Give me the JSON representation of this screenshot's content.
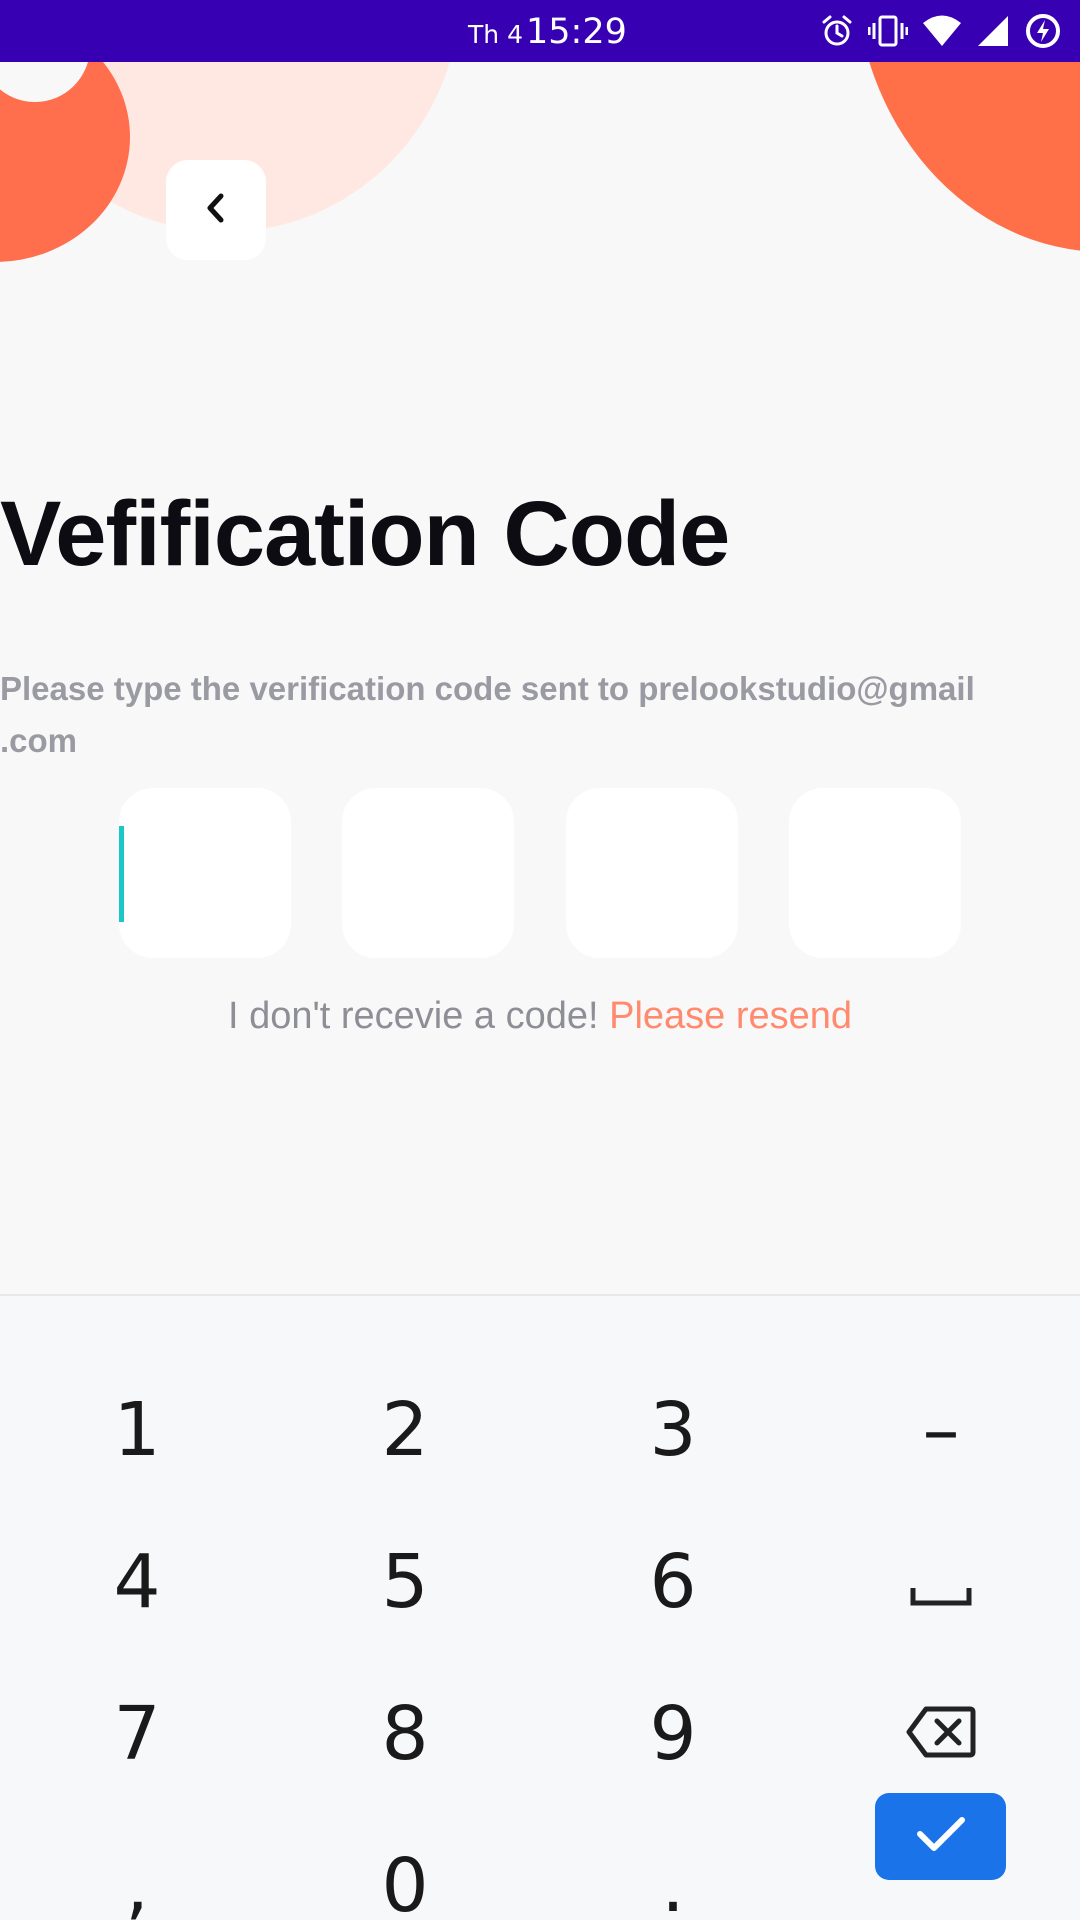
{
  "status_bar": {
    "date": "Th 4",
    "time": "15:29",
    "icons": [
      "alarm-icon",
      "vibrate-icon",
      "wifi-icon",
      "signal-icon",
      "battery-charging-icon"
    ],
    "bg_color": "#3700b3"
  },
  "header": {
    "back_icon": "chevron-left-icon"
  },
  "main": {
    "title": "Vefification Code",
    "subtitle_line1": "Please type the verification code sent to prelookstudio@gmail",
    "subtitle_line2": ".com",
    "code_boxes": [
      "",
      "",
      "",
      ""
    ],
    "resend_prefix": "I don't recevie a code!",
    "resend_link": "Please resend"
  },
  "colors": {
    "accent": "#ff8a6e",
    "decor_orange": "#ff7048",
    "decor_pink": "#ffe8e2",
    "cursor": "#1cc7c7",
    "keyboard_done": "#1a73e8"
  },
  "keyboard": {
    "keys": [
      [
        "1",
        "2",
        "3",
        "–"
      ],
      [
        "4",
        "5",
        "6",
        "space-icon"
      ],
      [
        "7",
        "8",
        "9",
        "backspace-icon"
      ],
      [
        ",",
        "0",
        ".",
        "check-icon"
      ]
    ],
    "k1": "1",
    "k2": "2",
    "k3": "3",
    "k_dash": "–",
    "k4": "4",
    "k5": "5",
    "k6": "6",
    "k7": "7",
    "k8": "8",
    "k9": "9",
    "k_comma": ",",
    "k0": "0",
    "k_period": "."
  }
}
